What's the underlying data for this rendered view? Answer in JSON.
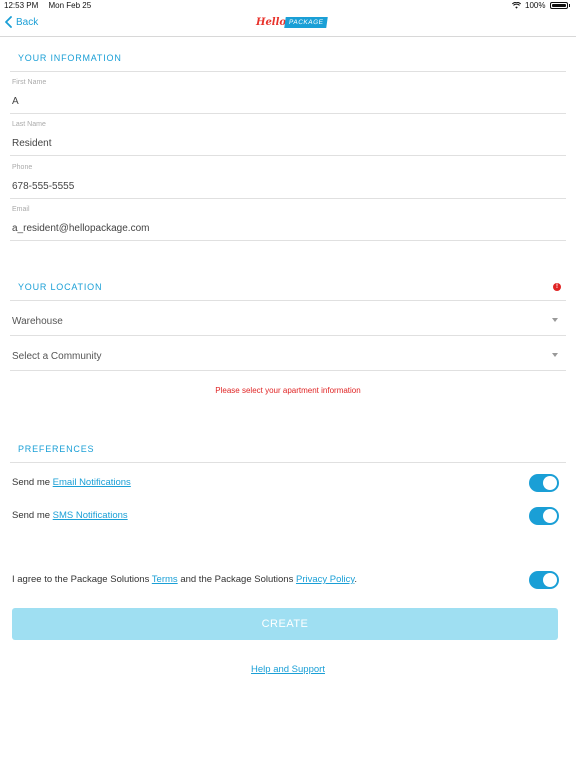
{
  "status_bar": {
    "time": "12:53 PM",
    "date": "Mon Feb 25",
    "battery": "100%"
  },
  "nav": {
    "back_label": "Back",
    "logo_hello": "Hello",
    "logo_package": "PACKAGE"
  },
  "info": {
    "title": "YOUR INFORMATION",
    "fields": [
      {
        "label": "First Name",
        "value": "A"
      },
      {
        "label": "Last Name",
        "value": "Resident"
      },
      {
        "label": "Phone",
        "value": "678-555-5555"
      },
      {
        "label": "Email",
        "value": "a_resident@hellopackage.com"
      }
    ]
  },
  "location": {
    "title": "YOUR LOCATION",
    "alert": "!",
    "building": "Warehouse",
    "community_placeholder": "Select a Community",
    "error": "Please select your apartment information"
  },
  "preferences": {
    "title": "PREFERENCES",
    "prefix": "Send me",
    "email_link": "Email Notifications",
    "sms_link": "SMS Notifications",
    "email_on": true,
    "sms_on": true
  },
  "agreement": {
    "text1": "I agree to the Package Solutions",
    "terms": "Terms",
    "text2": "and the Package Solutions",
    "privacy": "Privacy Policy",
    "text3": ".",
    "on": true
  },
  "create_label": "CREATE",
  "help_label": "Help and Support",
  "colors": {
    "accent": "#1a9fd6",
    "error": "#e02424",
    "button_disabled": "#9fdff2"
  }
}
